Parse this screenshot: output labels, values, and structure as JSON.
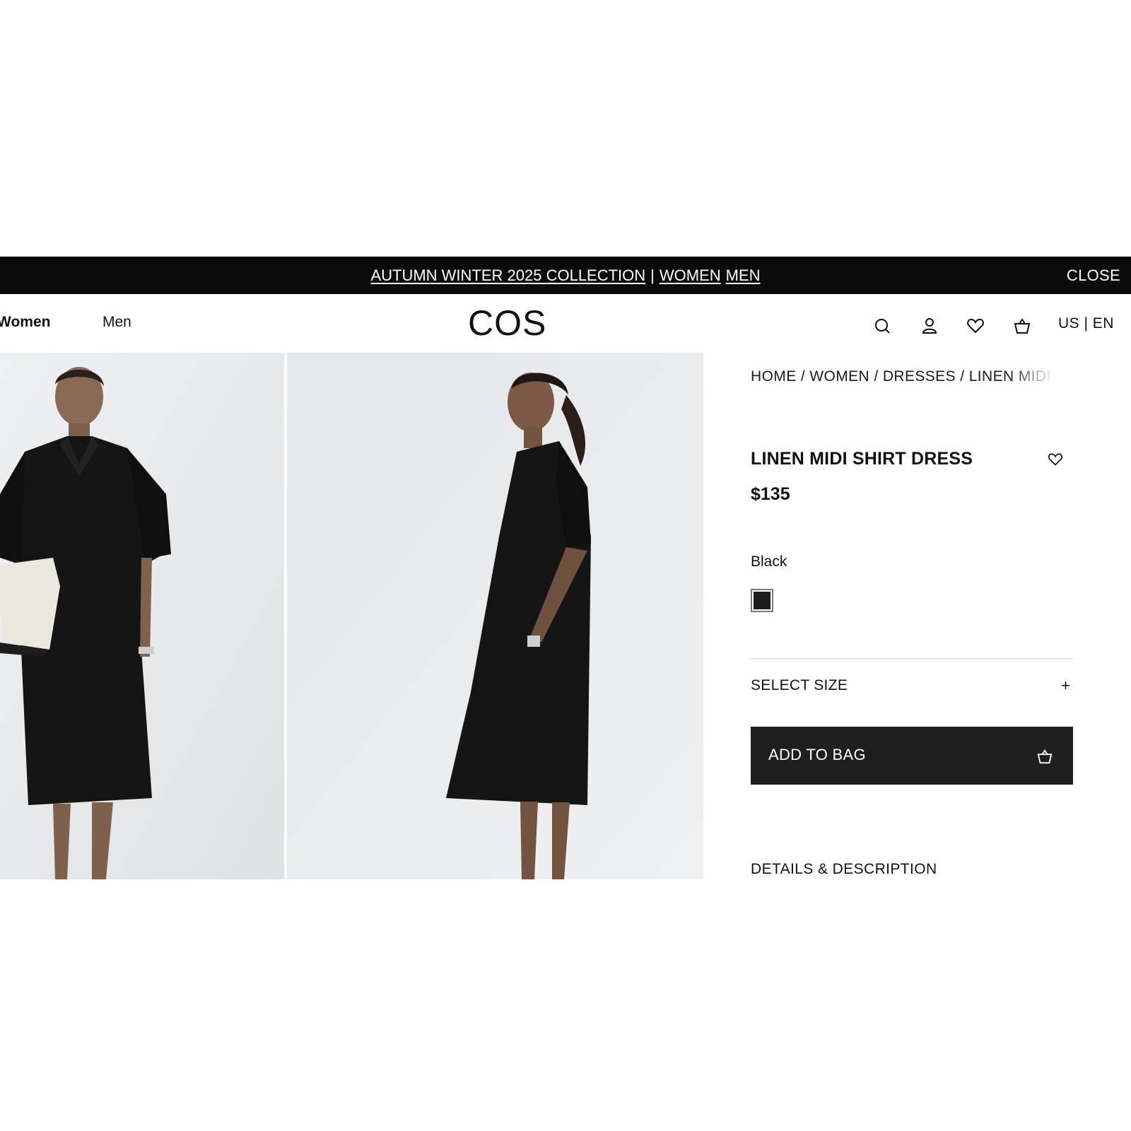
{
  "banner": {
    "collection_link": "AUTUMN WINTER 2025 COLLECTION",
    "separator": "|",
    "women_link": "WOMEN",
    "men_link": "MEN",
    "close_label": "CLOSE"
  },
  "header": {
    "nav_women": "Women",
    "nav_men": "Men",
    "logo": "COS",
    "icons": [
      "search-icon",
      "account-icon",
      "heart-icon",
      "bag-icon"
    ],
    "locale": "US | EN"
  },
  "gallery": {
    "images": [
      "model-front-holding-bag",
      "model-side-profile"
    ]
  },
  "product": {
    "breadcrumb": "HOME / WOMEN / DRESSES / LINEN MIDI SHIRT DRESS",
    "title": "LINEN MIDI SHIRT DRESS",
    "price": "$135",
    "color_name": "Black",
    "swatch_color": "#1c1c1c",
    "size_label": "SELECT SIZE",
    "size_toggle": "+",
    "add_to_bag": "ADD TO BAG",
    "details_label": "DETAILS & DESCRIPTION"
  },
  "colors": {
    "banner_bg": "#0b0b0b",
    "button_bg": "#1f1f1f",
    "photo_bg": "#e7e9ec"
  }
}
